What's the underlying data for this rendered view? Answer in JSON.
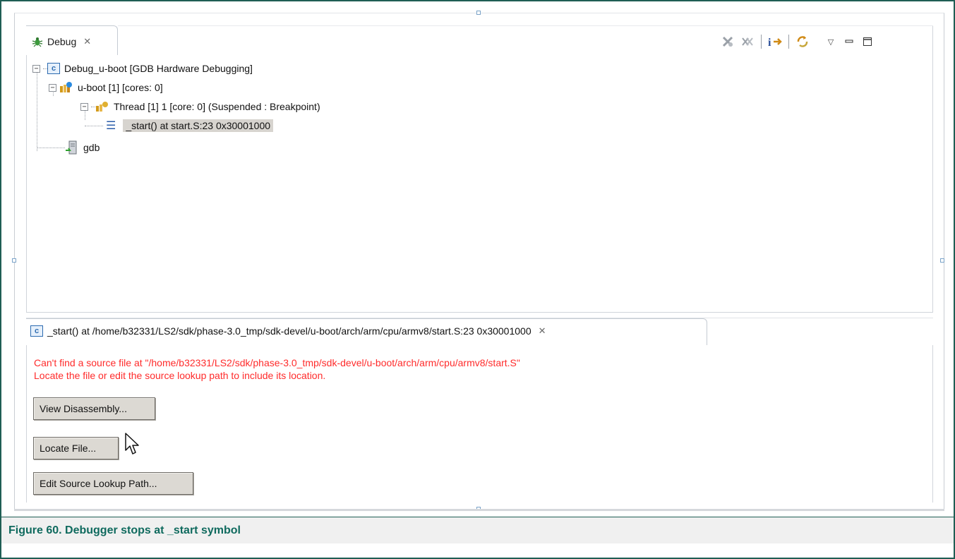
{
  "debug_view": {
    "tab_label": "Debug",
    "tab_icon": "bug-icon",
    "toolbar": {
      "icons": [
        "remove-terminated-icon",
        "remove-all-terminated-icon",
        "instruction-stepping-icon",
        "reset-icon",
        "view-menu-icon",
        "minimize-icon",
        "maximize-icon"
      ]
    },
    "tree": [
      {
        "label": "Debug_u-boot [GDB Hardware Debugging]",
        "icon": "c-launch-icon"
      },
      {
        "label": "u-boot [1] [cores: 0]",
        "icon": "process-icon"
      },
      {
        "label": "Thread [1] 1 [core: 0] (Suspended : Breakpoint)",
        "icon": "thread-icon"
      },
      {
        "label": "_start() at start.S:23 0x30001000",
        "icon": "stack-frame-icon",
        "selected": true
      },
      {
        "label": "gdb",
        "icon": "gdb-icon"
      }
    ]
  },
  "editor": {
    "tab_label": "_start() at /home/b32331/LS2/sdk/phase-3.0_tmp/sdk-devel/u-boot/arch/arm/cpu/armv8/start.S:23 0x30001000",
    "error_line1": "Can't find a source file at \"/home/b32331/LS2/sdk/phase-3.0_tmp/sdk-devel/u-boot/arch/arm/cpu/armv8/start.S\"",
    "error_line2": "Locate the file or edit the source lookup path to include its location.",
    "buttons": {
      "view_disassembly": "View Disassembly...",
      "locate_file": "Locate File...",
      "edit_lookup": "Edit Source Lookup Path..."
    }
  },
  "caption": "Figure 60. Debugger stops at _start symbol",
  "colors": {
    "frame": "#1f5e54",
    "caption_text": "#0f6a5e",
    "error_text": "#ff2b2b"
  }
}
